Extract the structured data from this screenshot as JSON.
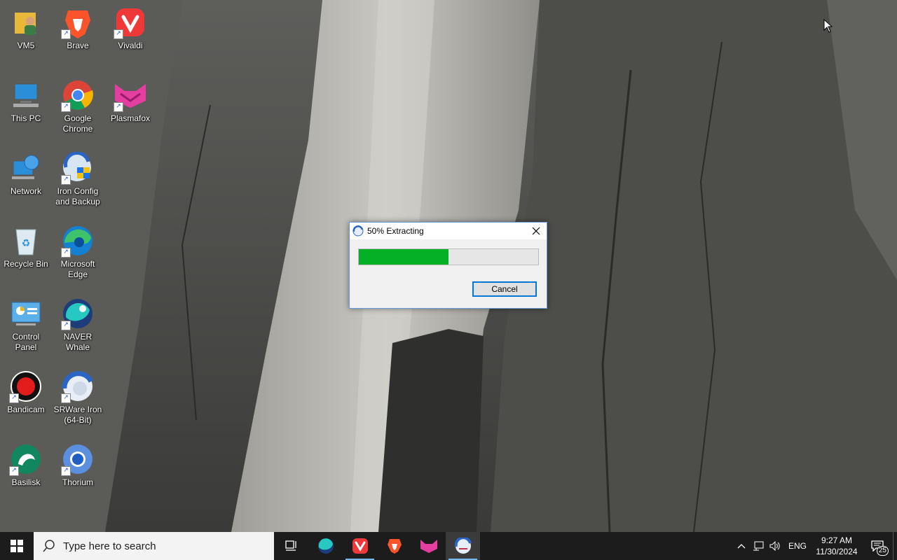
{
  "desktop": {
    "icons": [
      {
        "label": "VM5"
      },
      {
        "label": "Brave"
      },
      {
        "label": "Vivaldi"
      },
      {
        "label": "This PC"
      },
      {
        "label": "Google\nChrome"
      },
      {
        "label": "Plasmafox"
      },
      {
        "label": "Network"
      },
      {
        "label": "Iron Config\nand Backup"
      },
      {
        "label": "Recycle Bin"
      },
      {
        "label": "Microsoft\nEdge"
      },
      {
        "label": "Control\nPanel"
      },
      {
        "label": "NAVER\nWhale"
      },
      {
        "label": "Bandicam"
      },
      {
        "label": "SRWare Iron\n(64-Bit)"
      },
      {
        "label": "Basilisk"
      },
      {
        "label": "Thorium"
      }
    ]
  },
  "dialog": {
    "title": "50% Extracting",
    "progress_percent": 50,
    "cancel_label": "Cancel",
    "close_icon": "close-icon",
    "progress_color": "#06b025"
  },
  "taskbar": {
    "search_placeholder": "Type here to search",
    "pinned": [
      "task-view",
      "whale",
      "vivaldi",
      "brave",
      "plasmafox",
      "srware-iron"
    ],
    "tray": {
      "language": "ENG",
      "time": "9:27 AM",
      "date": "11/30/2024",
      "notification_count": "25"
    }
  }
}
